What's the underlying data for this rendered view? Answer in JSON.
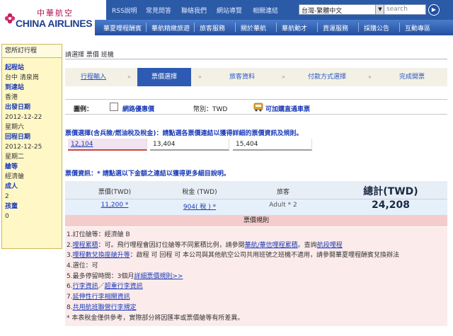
{
  "brand": {
    "name_cn": "中華航空",
    "name_en": "CHINA AIRLINES"
  },
  "toplinks": [
    "RSS說明",
    "常見問答",
    "聯絡我們",
    "網站導覽",
    "相關連結"
  ],
  "lang_select": {
    "value": "台灣-繁體中文"
  },
  "search": {
    "value": "search"
  },
  "nav": [
    "華夏哩程酬賓",
    "華航精緻旅遊",
    "旅客服務",
    "關於華航",
    "華航動才",
    "貨運服務",
    "採購公告",
    "互動專區"
  ],
  "sidebar": {
    "title": "您所訂行程",
    "items": [
      {
        "label": "起程站",
        "value": "台中 清泉崗"
      },
      {
        "label": "到達站",
        "value": "香港"
      },
      {
        "label": "出發日期",
        "value": "2012-12-22",
        "value2": "星期六"
      },
      {
        "label": "回程日期",
        "value": "2012-12-25",
        "value2": "星期二"
      },
      {
        "label": "艙等",
        "value": "經濟艙"
      },
      {
        "label": "成人",
        "value": "2"
      },
      {
        "label": "孩童",
        "value": "0"
      }
    ]
  },
  "breadcrumb": "請選擇 票價 班機",
  "steps": [
    "行程輸入",
    "票價選擇",
    "旅客資料",
    "付款方式選擇",
    "完成開票"
  ],
  "steps_arrow": "»",
  "legend": {
    "label": "圖例：",
    "web_fare": "網路優惠價",
    "currency": "幣別：TWD",
    "bus": "可加購直通車票"
  },
  "fare_select": {
    "heading": "票價選擇(含兵險/燃油稅及稅金)：請點選各票價連結以獲得詳細的票價資訊及規則。",
    "options": [
      "12,104",
      "13,404",
      "15,404"
    ]
  },
  "fare_info": {
    "heading": "票價資訊：* 請點選以下金額之連結以獲得更多細目說明。",
    "headers": {
      "fare": "票價(TWD)",
      "tax": "稅金 (TWD)",
      "passenger": "旅客",
      "total": "總計(TWD)"
    },
    "values": {
      "fare": "11,200 *",
      "tax": "904( 稅 ) *",
      "passenger": "Adult * 2",
      "total": "24,208"
    }
  },
  "rules": {
    "heading": "票價規則",
    "lines": [
      {
        "text": "1.訂位艙等：經濟艙 B"
      },
      {
        "prefix": "2.",
        "link": "哩程累積",
        "text": "：可。飛行哩程會因訂位艙等不同累積比例，請參閱",
        "link2": "華航/華信哩程累積",
        "text2": "。查詢",
        "link3": "航段哩程"
      },
      {
        "prefix": "3.",
        "link": "哩程數兌換座艙升等",
        "text": "：啟程 可 回程 可 本公司與其他航空公司共用班號之班機不適用，請參閱華夏哩程酬賓兌換辦法"
      },
      {
        "text": "4.選位：可"
      },
      {
        "prefix": "5.最多停留時間：3個月",
        "link": "詳細票價規則>>"
      },
      {
        "prefix": "6.",
        "link": "行李資訊",
        "text": "／",
        "link2": "超重行李資訊"
      },
      {
        "prefix": "7.",
        "link": "延伸性行李相關資訊"
      },
      {
        "prefix": "8.",
        "link": "共用航班聯營行李規定"
      },
      {
        "text": "* 本表稅金僅供參考，實際部分將因匯率或票價艙等有所差異。"
      }
    ]
  }
}
